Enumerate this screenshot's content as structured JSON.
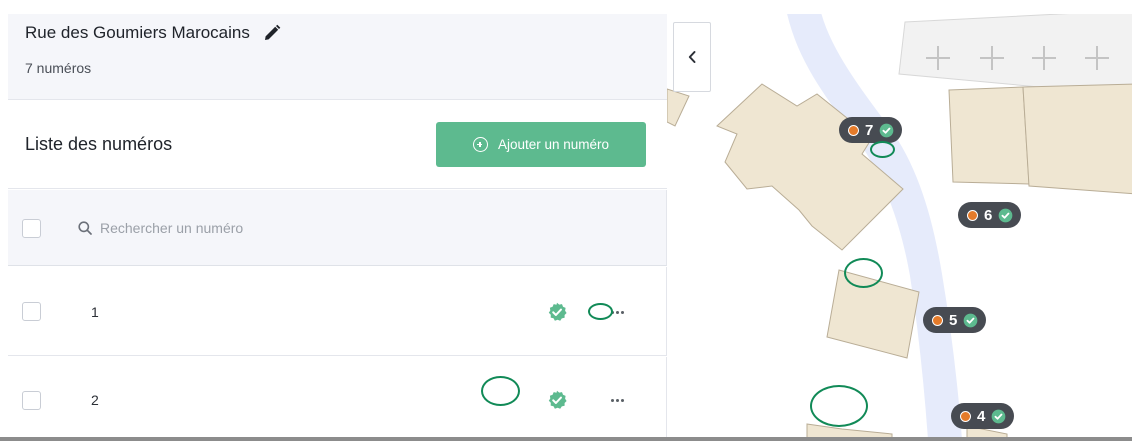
{
  "street": {
    "name": "Rue des Goumiers Marocains",
    "count_label": "7 numéros"
  },
  "list": {
    "title": "Liste des numéros",
    "add_button_label": "Ajouter un numéro",
    "search_placeholder": "Rechercher un numéro",
    "rows": [
      {
        "number": "1",
        "certified": true
      },
      {
        "number": "2",
        "certified": true
      }
    ]
  },
  "map": {
    "pins": [
      {
        "number": "7"
      },
      {
        "number": "6"
      },
      {
        "number": "5"
      },
      {
        "number": "4"
      }
    ]
  },
  "colors": {
    "accent_green": "#5dba8f",
    "annotation_green": "#118a57",
    "pin_background": "#474b52",
    "pin_dot": "#e57b2a",
    "building_fill": "#efe6d2",
    "road": "#e6ebfb"
  },
  "icons": {
    "edit": "pencil-icon",
    "add": "plus-circle-icon",
    "search": "search-icon",
    "certified": "check-circle-icon",
    "more": "ellipsis-icon",
    "collapse": "chevron-left-icon"
  }
}
